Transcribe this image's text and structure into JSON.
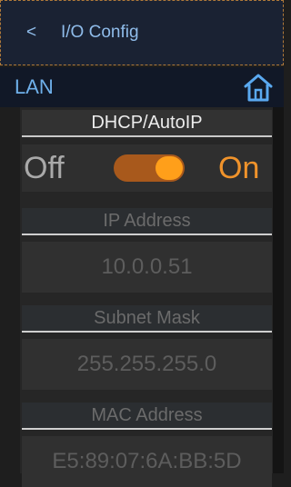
{
  "header": {
    "back_glyph": "<",
    "title": "I/O Config"
  },
  "subheader": {
    "label": "LAN",
    "home_icon": "home-icon",
    "accent": "#6fb0ea"
  },
  "dhcp": {
    "heading": "DHCP/AutoIP",
    "off_label": "Off",
    "on_label": "On",
    "state": "On",
    "toggle_color": "#ff9f1a"
  },
  "fields": {
    "ip_label": "IP Address",
    "ip_value": "10.0.0.51",
    "subnet_label": "Subnet Mask",
    "subnet_value": "255.255.255.0",
    "mac_label": "MAC Address",
    "mac_value": "E5:89:07:6A:BB:5D"
  }
}
